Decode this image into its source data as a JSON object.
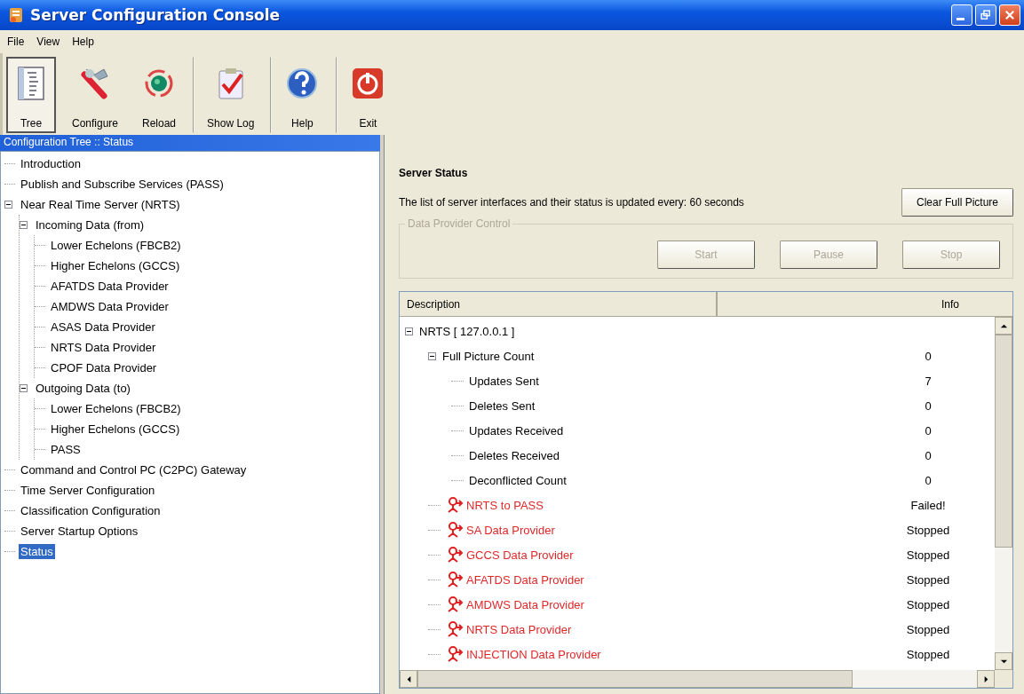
{
  "window": {
    "title": "Server Configuration Console"
  },
  "menu": [
    "File",
    "View",
    "Help"
  ],
  "toolbar": [
    {
      "label": "Tree",
      "kind": "tree",
      "pressed": true,
      "separator_before": false
    },
    {
      "label": "Configure",
      "kind": "tools",
      "pressed": false,
      "separator_before": false
    },
    {
      "label": "Reload",
      "kind": "reload",
      "pressed": false,
      "separator_before": false
    },
    {
      "label": "Show Log",
      "kind": "log",
      "pressed": false,
      "separator_before": true
    },
    {
      "label": "Help",
      "kind": "help",
      "pressed": false,
      "separator_before": true
    },
    {
      "label": "Exit",
      "kind": "exit",
      "pressed": false,
      "separator_before": true
    }
  ],
  "config_tree": {
    "title": "Configuration Tree :: Status",
    "items": [
      {
        "label": "Introduction",
        "selected": false
      },
      {
        "label": "Publish and Subscribe Services (PASS)",
        "selected": false
      },
      {
        "label": "Near Real Time Server (NRTS)",
        "selected": false,
        "expanded": true,
        "children": [
          {
            "label": "Incoming Data (from)",
            "selected": false,
            "expanded": true,
            "children": [
              {
                "label": "Lower Echelons (FBCB2)",
                "selected": false
              },
              {
                "label": "Higher Echelons (GCCS)",
                "selected": false
              },
              {
                "label": "AFATDS Data Provider",
                "selected": false
              },
              {
                "label": "AMDWS Data Provider",
                "selected": false
              },
              {
                "label": "ASAS Data Provider",
                "selected": false
              },
              {
                "label": "NRTS Data Provider",
                "selected": false
              },
              {
                "label": "CPOF Data Provider",
                "selected": false
              }
            ]
          },
          {
            "label": "Outgoing Data (to)",
            "selected": false,
            "expanded": true,
            "children": [
              {
                "label": "Lower Echelons (FBCB2)",
                "selected": false
              },
              {
                "label": "Higher Echelons (GCCS)",
                "selected": false
              },
              {
                "label": "PASS",
                "selected": false
              }
            ]
          }
        ]
      },
      {
        "label": "Command and Control PC (C2PC) Gateway",
        "selected": false
      },
      {
        "label": "Time Server Configuration",
        "selected": false
      },
      {
        "label": "Classification Configuration",
        "selected": false
      },
      {
        "label": "Server Startup Options",
        "selected": false
      },
      {
        "label": "Status",
        "selected": true
      }
    ]
  },
  "server_status": {
    "heading": "Server Status",
    "description": "The list of server interfaces and their status is updated every: 60 seconds",
    "clear_button": "Clear Full Picture",
    "provider_control": {
      "title": "Data Provider Control",
      "disabled": true,
      "buttons": [
        "Start",
        "Pause",
        "Stop"
      ]
    }
  },
  "status_list": {
    "columns": [
      "Description",
      "Info"
    ],
    "rows": [
      {
        "label": "NRTS [ 127.0.0.1 ]",
        "kind": "node",
        "expanded": true,
        "children": [
          {
            "label": "Full Picture Count",
            "kind": "node",
            "info": "0",
            "expanded": true,
            "children": [
              {
                "label": "Updates Sent",
                "kind": "node",
                "info": "7"
              },
              {
                "label": "Deletes Sent",
                "kind": "node",
                "info": "0"
              },
              {
                "label": "Updates Received",
                "kind": "node",
                "info": "0"
              },
              {
                "label": "Deletes Received",
                "kind": "node",
                "info": "0"
              },
              {
                "label": "Deconflicted Count",
                "kind": "node",
                "info": "0"
              }
            ]
          },
          {
            "label": "NRTS to PASS",
            "kind": "interface",
            "info": "Failed!"
          },
          {
            "label": "SA Data Provider",
            "kind": "interface",
            "info": "Stopped"
          },
          {
            "label": "GCCS Data Provider",
            "kind": "interface",
            "info": "Stopped"
          },
          {
            "label": "AFATDS Data Provider",
            "kind": "interface",
            "info": "Stopped"
          },
          {
            "label": "AMDWS Data Provider",
            "kind": "interface",
            "info": "Stopped"
          },
          {
            "label": "NRTS Data Provider",
            "kind": "interface",
            "info": "Stopped"
          },
          {
            "label": "INJECTION Data Provider",
            "kind": "interface",
            "info": "Stopped"
          }
        ]
      }
    ]
  }
}
